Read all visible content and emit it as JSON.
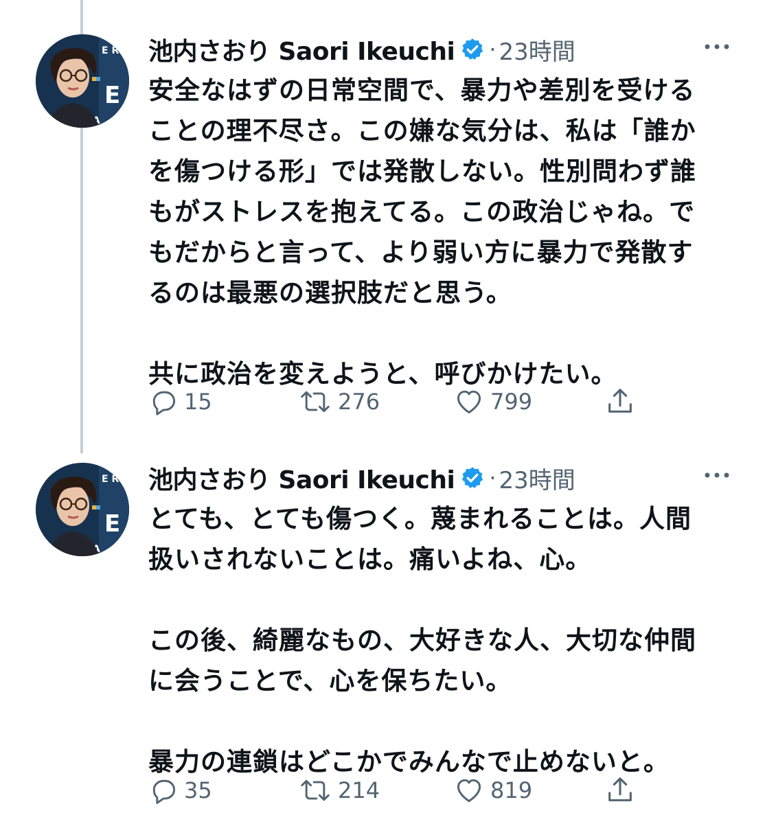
{
  "colors": {
    "text": "#0f1419",
    "secondary": "#536471",
    "verified": "#1d9bf0",
    "thread_line": "#c4cfd6"
  },
  "avatar": {
    "letters_top": "E R",
    "letter_big": "E",
    "letters_bottom": "QUA"
  },
  "tweets": [
    {
      "author": "池内さおり Saori Ikeuchi",
      "time": "23時間",
      "separator": "·",
      "verified_icon": "verified-badge-icon",
      "more_icon": "more-dots-icon",
      "lines": [
        "安全なはずの日常空間で、暴力や差別を受ける",
        "ことの理不尽さ。この嫌な気分は、私は「誰か",
        "を傷つける形」では発散しない。性別問わず誰",
        "もがストレスを抱えてる。この政治じゃね。で",
        "もだからと言って、より弱い方に暴力で発散す",
        "るのは最悪の選択肢だと思う。",
        "",
        "共に政治を変えようと、呼びかけたい。"
      ],
      "replies": "15",
      "retweets": "276",
      "likes": "799"
    },
    {
      "author": "池内さおり Saori Ikeuchi",
      "time": "23時間",
      "separator": "·",
      "verified_icon": "verified-badge-icon",
      "more_icon": "more-dots-icon",
      "lines": [
        "とても、とても傷つく。蔑まれることは。人間",
        "扱いされないことは。痛いよね、心。",
        "",
        "この後、綺麗なもの、大好きな人、大切な仲間",
        "に会うことで、心を保ちたい。",
        "",
        "暴力の連鎖はどこかでみんなで止めないと。"
      ],
      "replies": "35",
      "retweets": "214",
      "likes": "819"
    }
  ]
}
